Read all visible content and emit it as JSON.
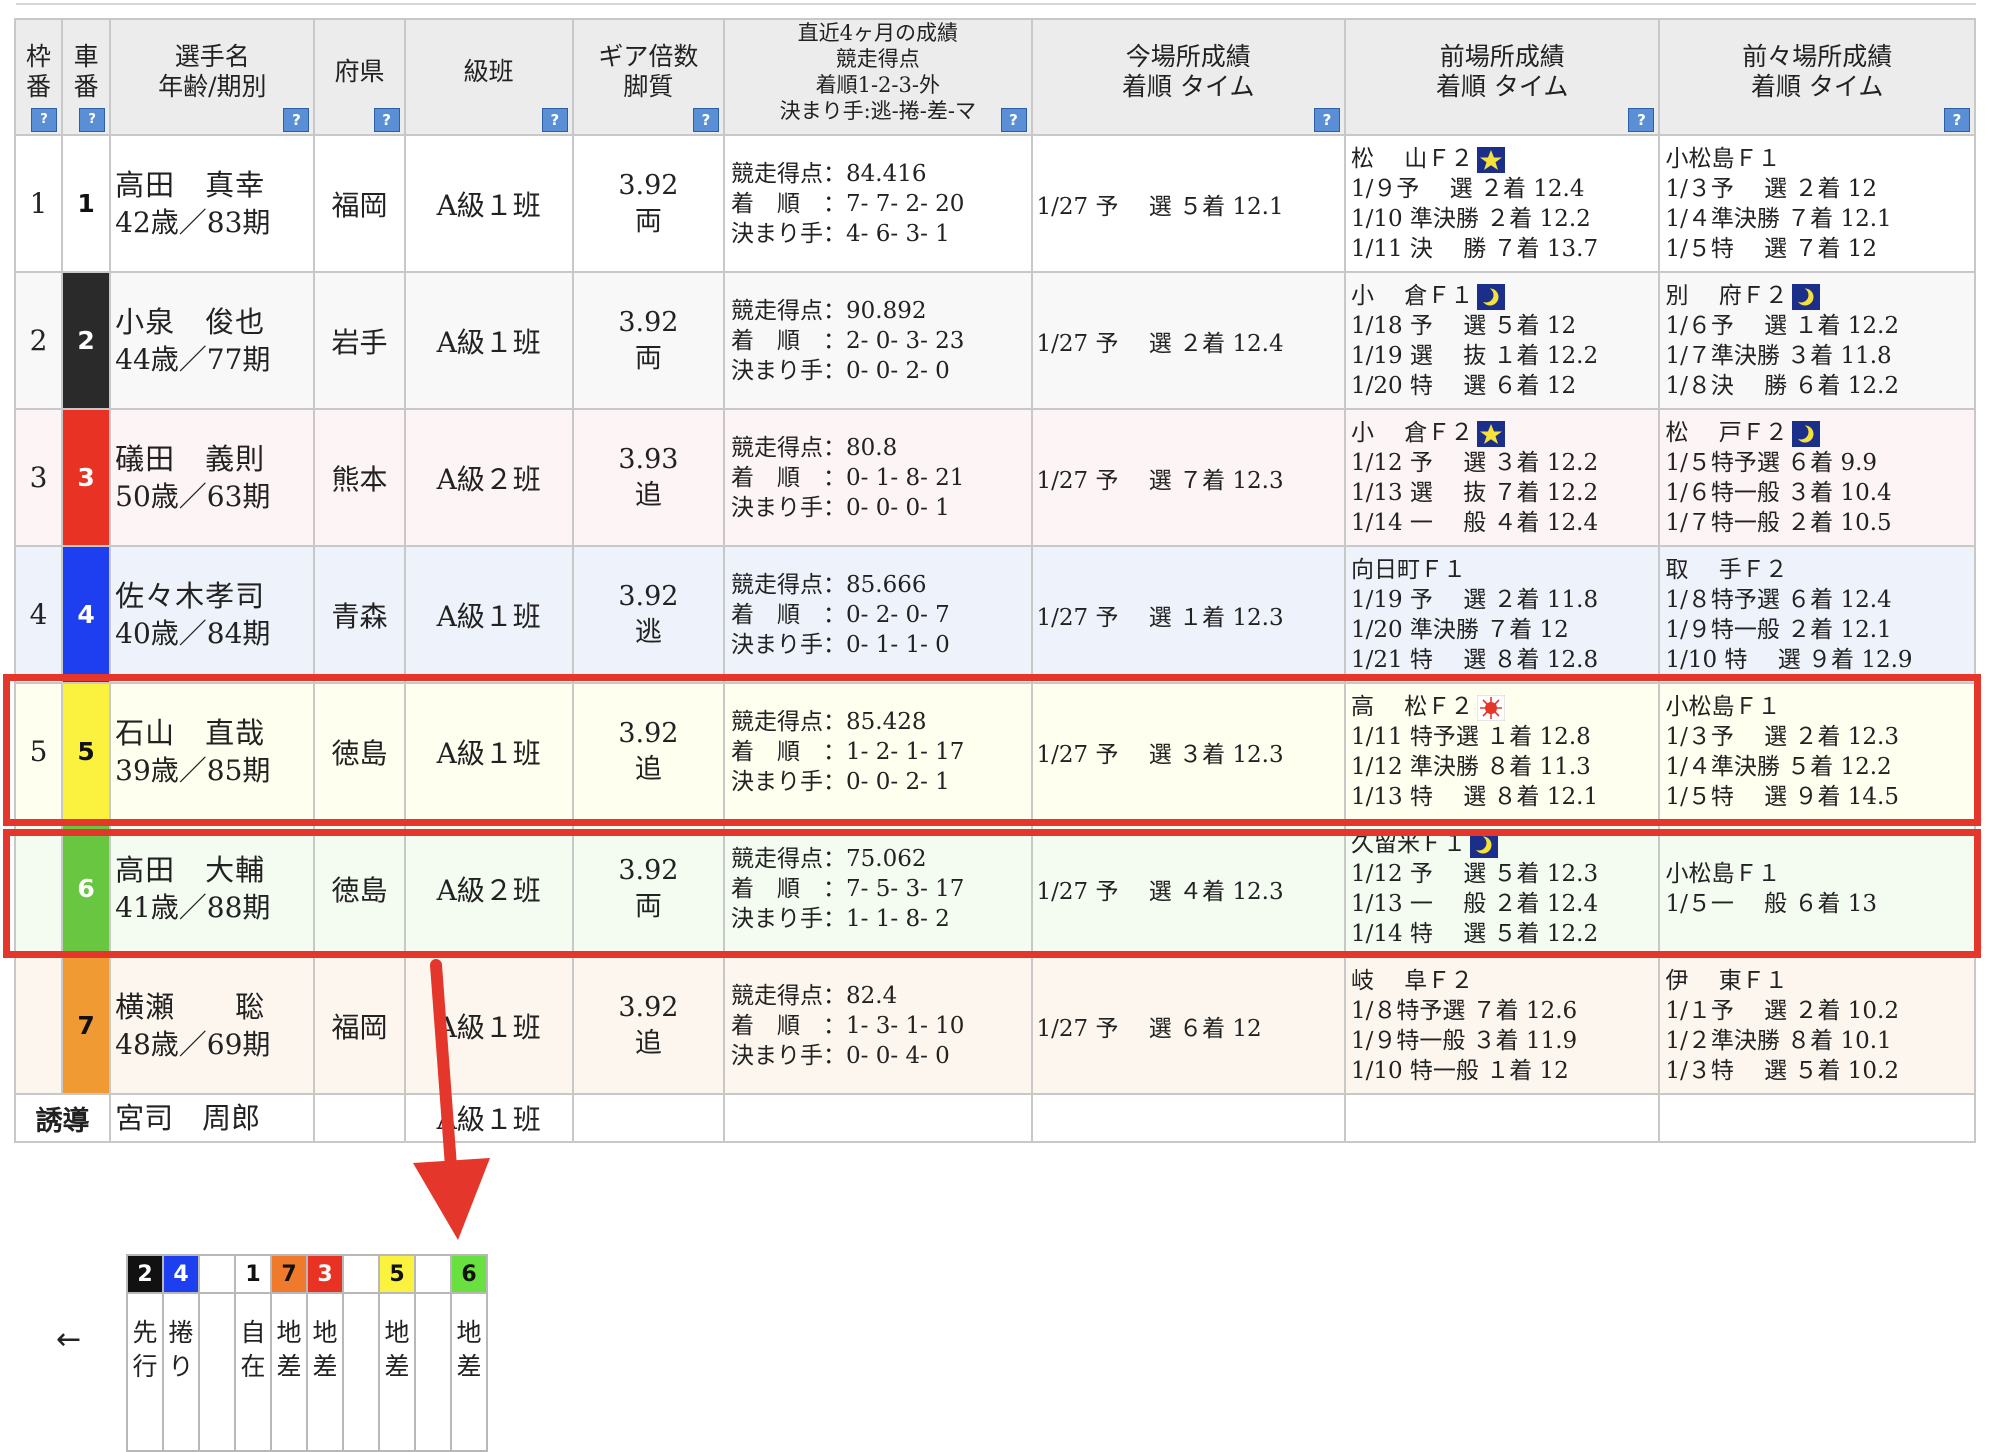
{
  "header": {
    "waku": "枠番",
    "sha": "車番",
    "name": [
      "選手名",
      "年齢/期別"
    ],
    "pref": "府県",
    "class": "級班",
    "gear": [
      "ギア倍数",
      "脚質"
    ],
    "recent": [
      "直近4ヶ月の成績",
      "競走得点",
      "着順1-2-3-外",
      "決まり手:逃-捲-差-マ"
    ],
    "current": [
      "今場所成績",
      "着順 タイム"
    ],
    "prev": [
      "前場所成績",
      "着順 タイム"
    ],
    "prev2": [
      "前々場所成績",
      "着順 タイム"
    ],
    "help_glyph": "?"
  },
  "colors": {
    "waku": [
      "#ffffff",
      "#2a2a2a",
      "#e83324",
      "#1e3ff0",
      "#fbf13f",
      "#68c640",
      "#ef9a32"
    ],
    "num_text": [
      "#111111",
      "#ffffff",
      "#ffffff",
      "#ffffff",
      "#111111",
      "#ffffff",
      "#111111"
    ],
    "row_bg": [
      "#ffffff",
      "#f8f8f8",
      "#fdf5f5",
      "#eef3fb",
      "#fffff0",
      "#f4fbf1",
      "#fdf6ee"
    ],
    "highlight": "#e5362b"
  },
  "rows": [
    {
      "waku": "1",
      "num": "1",
      "name": "高田　真幸",
      "age": "42歳／83期",
      "pref": "福岡",
      "class": "A級１班",
      "gear": "3.92",
      "style": "両",
      "score": "競走得点：84.416",
      "order": "着　順　：7- 7- 2- 20",
      "kimarite": "決まり手：4- 6- 3- 1",
      "current": "1/27 予　 選 ５着 12.1",
      "prev_head": "松　 山Ｆ２",
      "prev_icon": "star",
      "prev": [
        "1/９予　 選 ２着 12.4",
        "1/10 準決勝 ２着 12.2",
        "1/11 決　 勝 ７着 13.7"
      ],
      "prev2_head": "小松島Ｆ１",
      "prev2_icon": "",
      "prev2": [
        "1/３予　 選 ２着 12",
        "1/４準決勝 ７着 12.1",
        "1/５特　 選 ７着 12"
      ]
    },
    {
      "waku": "2",
      "num": "2",
      "name": "小泉　俊也",
      "age": "44歳／77期",
      "pref": "岩手",
      "class": "A級１班",
      "gear": "3.92",
      "style": "両",
      "score": "競走得点：90.892",
      "order": "着　順　：2- 0- 3- 23",
      "kimarite": "決まり手：0- 0- 2- 0",
      "current": "1/27 予　 選 ２着 12.4",
      "prev_head": "小　 倉Ｆ１",
      "prev_icon": "moon",
      "prev": [
        "1/18 予　 選 ５着 12",
        "1/19 選　 抜 １着 12.2",
        "1/20 特　 選 ６着 12"
      ],
      "prev2_head": "別　 府Ｆ２",
      "prev2_icon": "moon",
      "prev2": [
        "1/６予　 選 １着 12.2",
        "1/７準決勝 ３着 11.8",
        "1/８決　 勝 ６着 12.2"
      ]
    },
    {
      "waku": "3",
      "num": "3",
      "name": "礒田　義則",
      "age": "50歳／63期",
      "pref": "熊本",
      "class": "A級２班",
      "gear": "3.93",
      "style": "追",
      "score": "競走得点：80.8",
      "order": "着　順　：0- 1- 8- 21",
      "kimarite": "決まり手：0- 0- 0- 1",
      "current": "1/27 予　 選 ７着 12.3",
      "prev_head": "小　 倉Ｆ２",
      "prev_icon": "star",
      "prev": [
        "1/12 予　 選 ３着 12.2",
        "1/13 選　 抜 ７着 12.2",
        "1/14 一　 般 ４着 12.4"
      ],
      "prev2_head": "松　 戸Ｆ２",
      "prev2_icon": "moon",
      "prev2": [
        "1/５特予選 ６着 9.9",
        "1/６特一般 ３着 10.4",
        "1/７特一般 ２着 10.5"
      ]
    },
    {
      "waku": "4",
      "num": "4",
      "name": "佐々木孝司",
      "age": "40歳／84期",
      "pref": "青森",
      "class": "A級１班",
      "gear": "3.92",
      "style": "逃",
      "score": "競走得点：85.666",
      "order": "着　順　：0- 2- 0- 7",
      "kimarite": "決まり手：0- 1- 1- 0",
      "current": "1/27 予　 選 １着 12.3",
      "prev_head": "向日町Ｆ１",
      "prev_icon": "",
      "prev": [
        "1/19 予　 選 ２着 11.8",
        "1/20 準決勝 ７着 12",
        "1/21 特　 選 ８着 12.8"
      ],
      "prev2_head": "取　 手Ｆ２",
      "prev2_icon": "",
      "prev2": [
        "1/８特予選 ６着 12.4",
        "1/９特一般 ２着 12.1",
        "1/10 特　 選 ９着 12.9"
      ]
    },
    {
      "waku": "5",
      "num": "5",
      "name": "石山　直哉",
      "age": "39歳／85期",
      "pref": "徳島",
      "class": "A級１班",
      "gear": "3.92",
      "style": "追",
      "score": "競走得点：85.428",
      "order": "着　順　：1- 2- 1- 17",
      "kimarite": "決まり手：0- 0- 2- 1",
      "current": "1/27 予　 選 ３着 12.3",
      "prev_head": "高　 松Ｆ２",
      "prev_icon": "sun",
      "prev": [
        "1/11 特予選 １着 12.8",
        "1/12 準決勝 ８着 11.3",
        "1/13 特　 選 ８着 12.1"
      ],
      "prev2_head": "小松島Ｆ１",
      "prev2_icon": "",
      "prev2": [
        "1/３予　 選 ２着 12.3",
        "1/４準決勝 ５着 12.2",
        "1/５特　 選 ９着 14.5"
      ]
    },
    {
      "waku": "",
      "num": "6",
      "name": "高田　大輔",
      "age": "41歳／88期",
      "pref": "徳島",
      "class": "A級２班",
      "gear": "3.92",
      "style": "両",
      "score": "競走得点：75.062",
      "order": "着　順　：7- 5- 3- 17",
      "kimarite": "決まり手：1- 1- 8- 2",
      "current": "1/27 予　 選 ４着 12.3",
      "prev_head": "久留米Ｆ１",
      "prev_icon": "moon",
      "prev": [
        "1/12 予　 選 ５着 12.3",
        "1/13 一　 般 ２着 12.4",
        "1/14 特　 選 ５着 12.2"
      ],
      "prev2_head": "小松島Ｆ１",
      "prev2_icon": "",
      "prev2": [
        "1/５一　 般 ６着 13"
      ]
    },
    {
      "waku": "",
      "num": "7",
      "name": "横瀬　　聡",
      "age": "48歳／69期",
      "pref": "福岡",
      "class": "A級１班",
      "gear": "3.92",
      "style": "追",
      "score": "競走得点：82.4",
      "order": "着　順　：1- 3- 1- 10",
      "kimarite": "決まり手：0- 0- 4- 0",
      "current": "1/27 予　 選 ６着 12",
      "prev_head": "岐　 阜Ｆ２",
      "prev_icon": "",
      "prev": [
        "1/８特予選 ７着 12.6",
        "1/９特一般 ３着 11.9",
        "1/10 特一般 １着 12"
      ],
      "prev2_head": "伊　 東Ｆ１",
      "prev2_icon": "",
      "prev2": [
        "1/１予　 選 ２着 10.2",
        "1/２準決勝 ８着 10.1",
        "1/３特　 選 ５着 10.2"
      ]
    }
  ],
  "guide": {
    "label": "誘導",
    "name": "宮司　周郎",
    "class": "A級１班"
  },
  "line_prediction": {
    "direction": "←",
    "cells": [
      {
        "num": "2",
        "bg": "#111111",
        "fg": "#ffffff",
        "tag": "先\n行"
      },
      {
        "num": "4",
        "bg": "#1e3ff0",
        "fg": "#ffffff",
        "tag": "捲\nり"
      },
      {
        "num": "",
        "bg": "#ffffff",
        "fg": "#111111",
        "tag": ""
      },
      {
        "num": "1",
        "bg": "#ffffff",
        "fg": "#111111",
        "tag": "自\n在"
      },
      {
        "num": "7",
        "bg": "#f07a2c",
        "fg": "#111111",
        "tag": "地\n差"
      },
      {
        "num": "3",
        "bg": "#e83324",
        "fg": "#ffffff",
        "tag": "地\n差"
      },
      {
        "num": "",
        "bg": "#ffffff",
        "fg": "#111111",
        "tag": ""
      },
      {
        "num": "5",
        "bg": "#fbf13f",
        "fg": "#111111",
        "tag": "地\n差"
      },
      {
        "num": "",
        "bg": "#ffffff",
        "fg": "#111111",
        "tag": ""
      },
      {
        "num": "6",
        "bg": "#68e040",
        "fg": "#111111",
        "tag": "地\n差"
      }
    ]
  }
}
